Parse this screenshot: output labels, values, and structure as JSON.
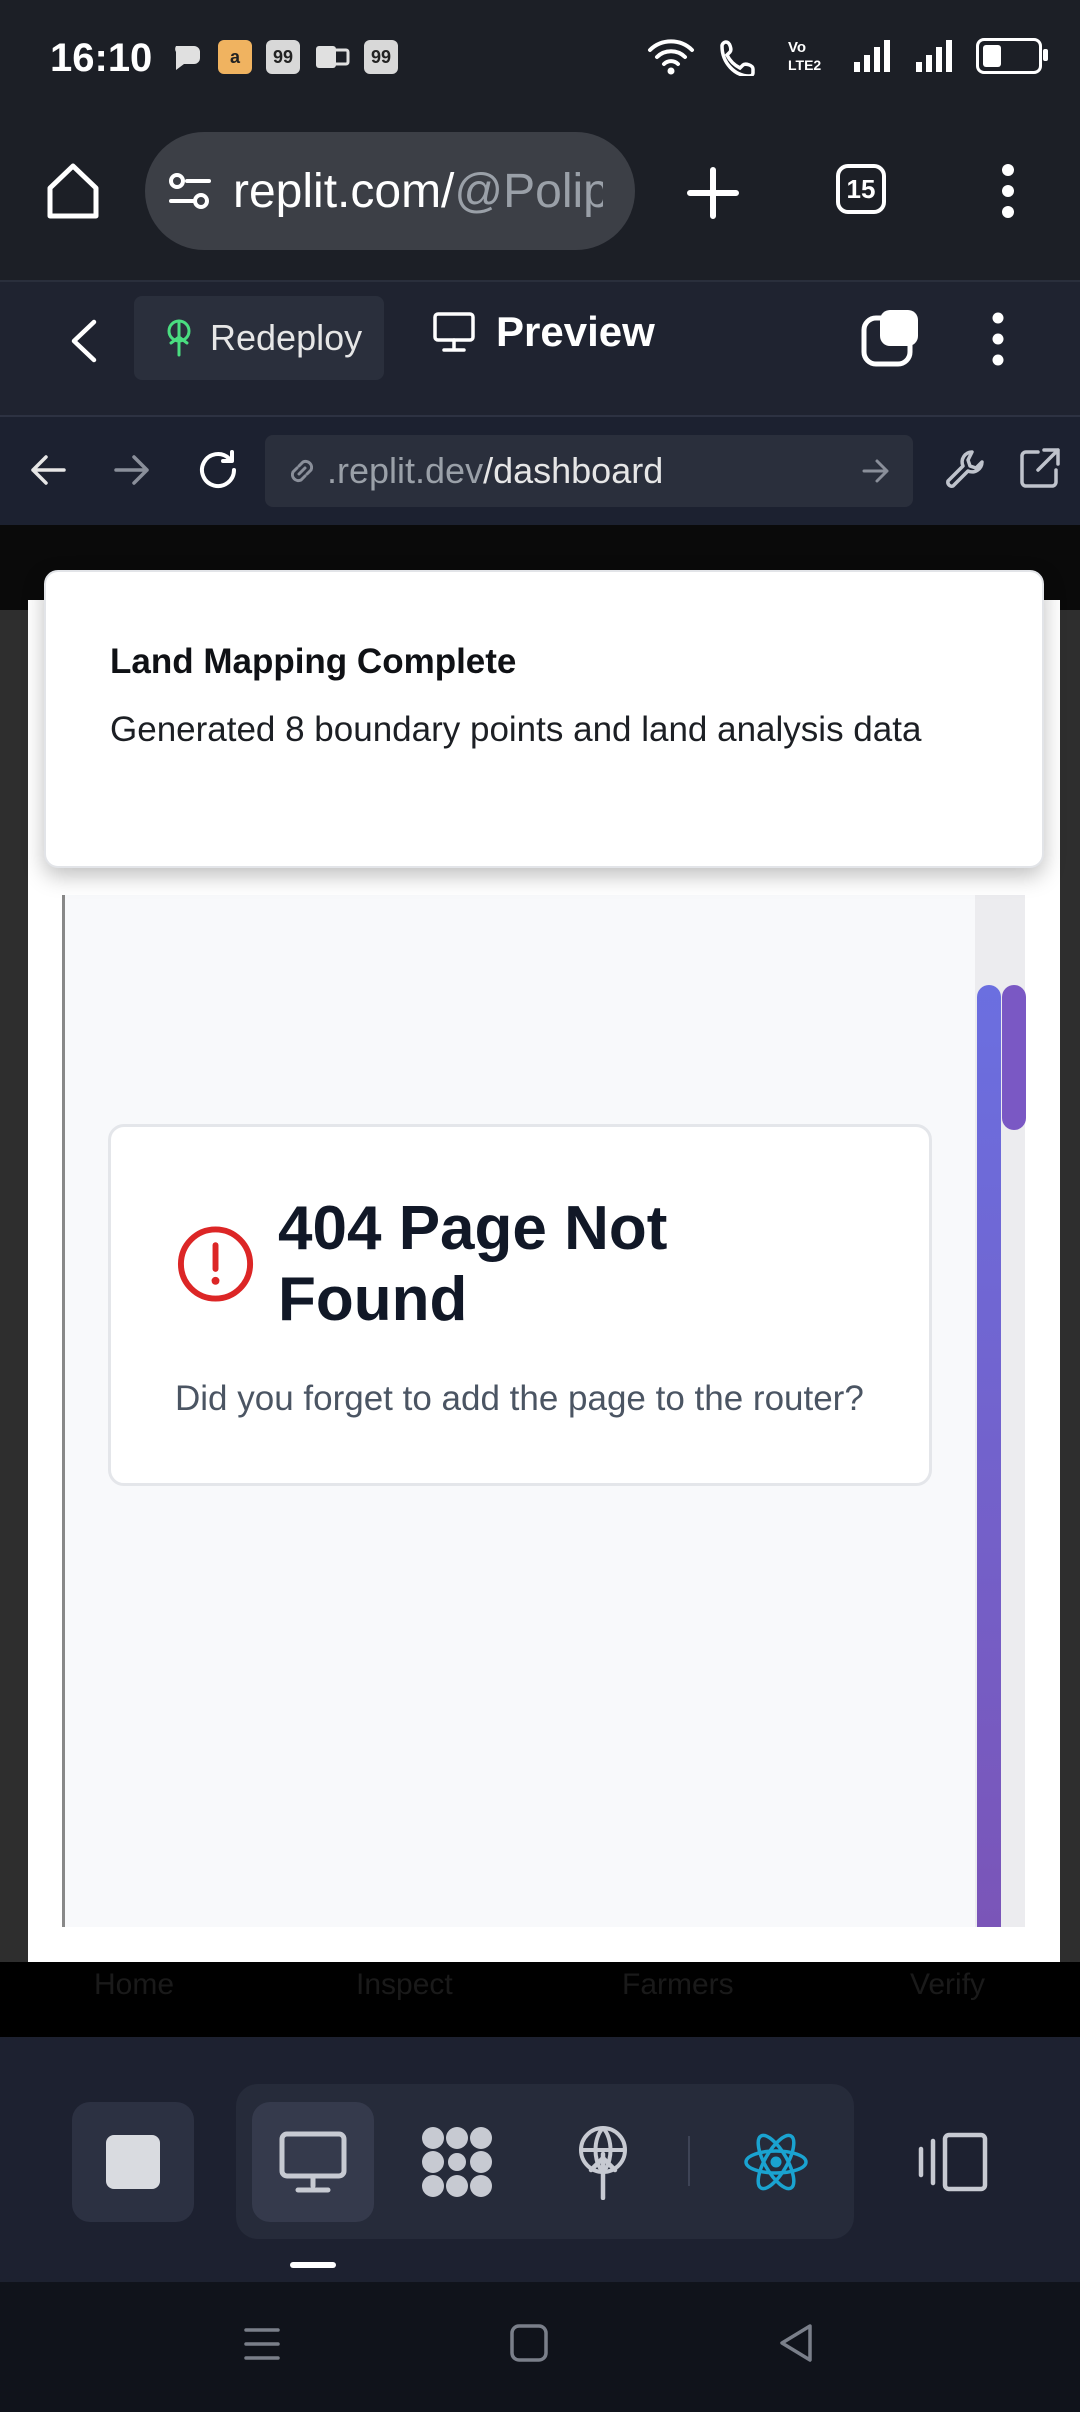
{
  "status_bar": {
    "time": "16:10",
    "notification_badges": [
      "99",
      "99"
    ]
  },
  "browser": {
    "url_host": "replit.com/",
    "url_path": "@Polip",
    "tab_count": "15"
  },
  "replit_toolbar": {
    "redeploy_label": "Redeploy",
    "preview_label": "Preview"
  },
  "webview": {
    "url_domain": ".replit.dev",
    "url_path": "/dashboard"
  },
  "toast": {
    "title": "Land Mapping Complete",
    "description": "Generated 8 boundary points and land analysis data"
  },
  "not_found": {
    "title": "404 Page Not Found",
    "message": "Did you forget to add the page to the router?"
  },
  "ghost_nav": [
    "Home",
    "Inspect",
    "Farmers",
    "Verify"
  ],
  "colors": {
    "accent_error": "#dc2626",
    "scroll_gradient_top": "#6b6fe0",
    "scroll_gradient_bottom": "#7a55b8",
    "react_icon": "#1aa3d0",
    "redeploy_icon": "#4ade80"
  }
}
